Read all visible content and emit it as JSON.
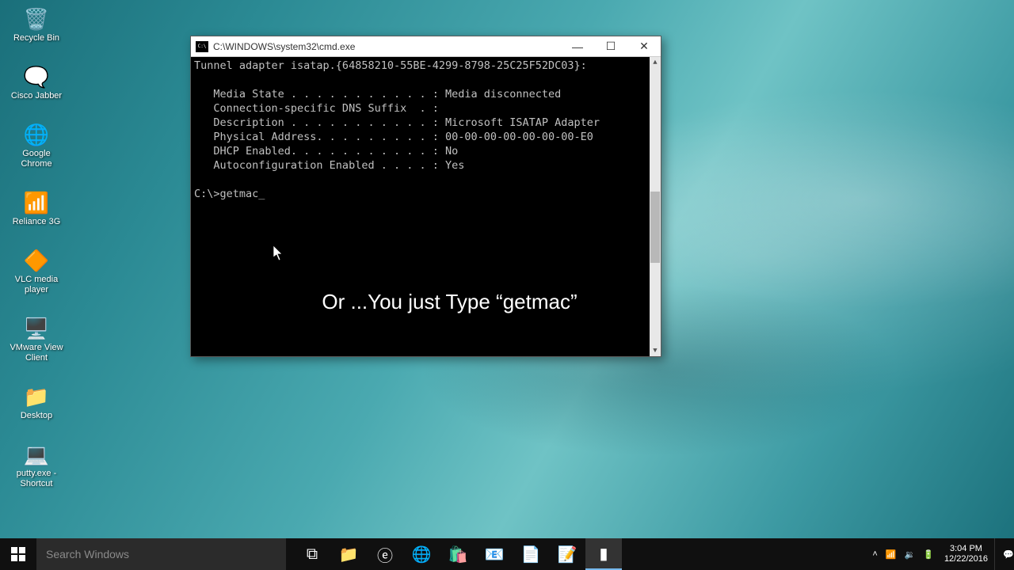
{
  "desktop": {
    "icons": [
      {
        "name": "recycle-bin",
        "label": "Recycle Bin",
        "glyph": "🗑️"
      },
      {
        "name": "cisco-jabber",
        "label": "Cisco Jabber",
        "glyph": "🗨️"
      },
      {
        "name": "google-chrome",
        "label": "Google Chrome",
        "glyph": "🌐"
      },
      {
        "name": "reliance-3g",
        "label": "Reliance 3G",
        "glyph": "📶"
      },
      {
        "name": "vlc-media-player",
        "label": "VLC media player",
        "glyph": "🔶"
      },
      {
        "name": "vmware-view-client",
        "label": "VMware View Client",
        "glyph": "🖥️"
      },
      {
        "name": "desktop-folder",
        "label": "Desktop",
        "glyph": "📁"
      },
      {
        "name": "putty-shortcut",
        "label": "putty.exe - Shortcut",
        "glyph": "💻"
      }
    ]
  },
  "cmd": {
    "title": "C:\\WINDOWS\\system32\\cmd.exe",
    "lines": [
      "Tunnel adapter isatap.{64858210-55BE-4299-8798-25C25F52DC03}:",
      "",
      "   Media State . . . . . . . . . . . : Media disconnected",
      "   Connection-specific DNS Suffix  . :",
      "   Description . . . . . . . . . . . : Microsoft ISATAP Adapter",
      "   Physical Address. . . . . . . . . : 00-00-00-00-00-00-00-E0",
      "   DHCP Enabled. . . . . . . . . . . : No",
      "   Autoconfiguration Enabled . . . . : Yes",
      ""
    ],
    "prompt": "C:\\>",
    "command": "getmac",
    "caption": "Or ...You just Type “getmac”"
  },
  "taskbar": {
    "search_placeholder": "Search Windows",
    "pinned": [
      {
        "name": "task-view",
        "glyph": "⧉"
      },
      {
        "name": "file-explorer",
        "glyph": "📁"
      },
      {
        "name": "internet-explorer",
        "glyph": "ⓔ"
      },
      {
        "name": "chrome",
        "glyph": "🌐"
      },
      {
        "name": "store",
        "glyph": "🛍️"
      },
      {
        "name": "outlook",
        "glyph": "📧"
      },
      {
        "name": "notepad",
        "glyph": "📄"
      },
      {
        "name": "notepad-plus",
        "glyph": "📝"
      },
      {
        "name": "cmd",
        "glyph": "▮",
        "active": true
      }
    ],
    "tray": {
      "up": "˄",
      "network": "📶",
      "volume": "🔉",
      "battery": "🔋",
      "time": "3:04 PM",
      "date": "12/22/2016",
      "notif": "💬"
    }
  }
}
